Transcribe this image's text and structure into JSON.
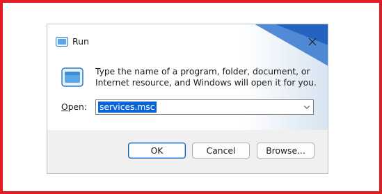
{
  "window": {
    "title": "Run",
    "icon": "run-icon",
    "close_icon": "close-icon"
  },
  "dialog": {
    "description": "Type the name of a program, folder, document, or Internet resource, and Windows will open it for you.",
    "open_label": "Open:",
    "open_value": "services.msc"
  },
  "buttons": {
    "ok": "OK",
    "cancel": "Cancel",
    "browse": "Browse..."
  },
  "colors": {
    "border_highlight": "#e31b23",
    "selection": "#0a64d6",
    "footer": "#f0f0f0"
  }
}
